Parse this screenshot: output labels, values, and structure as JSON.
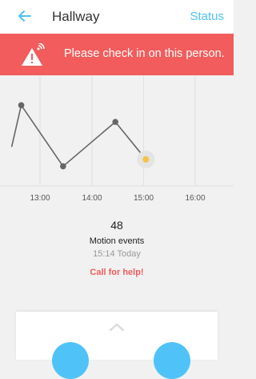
{
  "header": {
    "title": "Hallway",
    "status_label": "Status"
  },
  "alert": {
    "message": "Please check in on this person."
  },
  "chart_data": {
    "type": "line",
    "x_tick_labels": [
      "13:00",
      "14:00",
      "15:00",
      "16:00"
    ],
    "points": [
      {
        "time": "12:40",
        "value": 1
      },
      {
        "time": "12:51",
        "value": 2.5
      },
      {
        "time": "13:39",
        "value": 0.3
      },
      {
        "time": "14:39",
        "value": 1.9
      },
      {
        "time": "15:14",
        "value": 0.55
      }
    ],
    "ylim": [
      0,
      3
    ],
    "grid": true,
    "current_point_color": "#f5c342",
    "line_color": "#666666"
  },
  "stats": {
    "count": "48",
    "label": "Motion events",
    "time": "15:14 Today"
  },
  "help": {
    "label": "Call for help!"
  },
  "colors": {
    "accent": "#4fc3f7",
    "alert": "#f25c5c"
  }
}
